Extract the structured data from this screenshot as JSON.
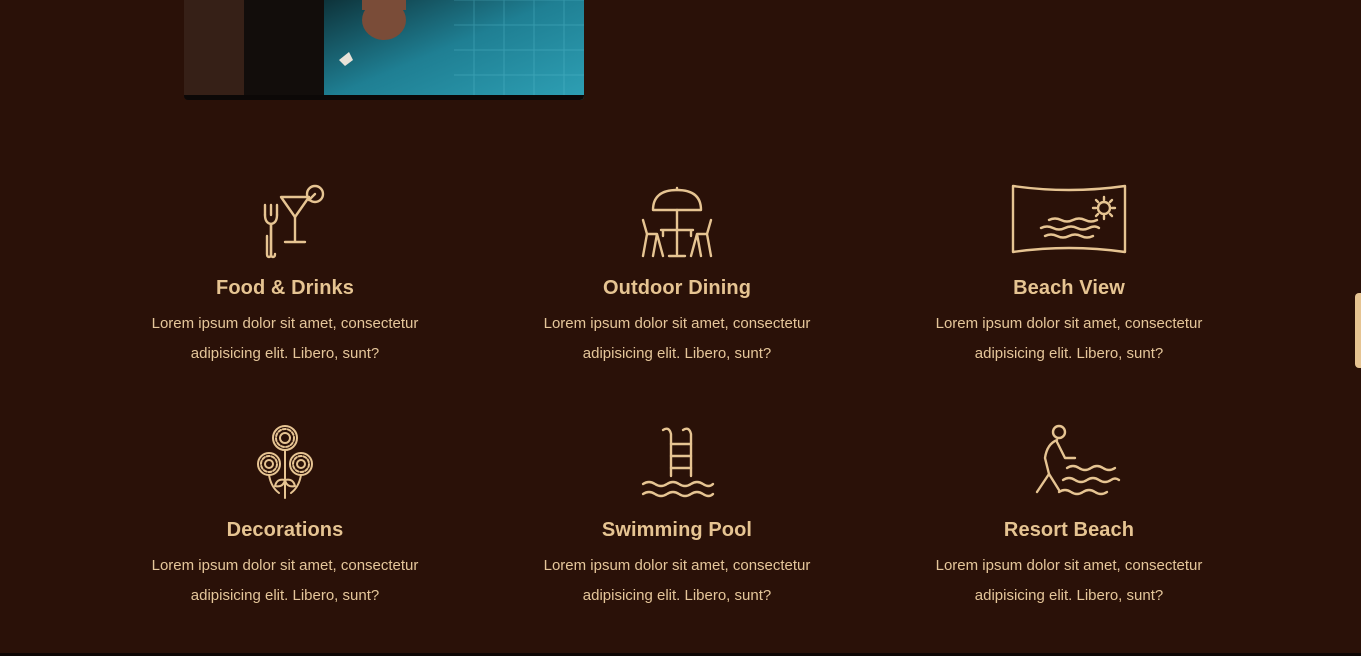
{
  "hero": {
    "image_label": "Person sitting at pool edge with feet in water"
  },
  "colors": {
    "background": "#2a1108",
    "accent": "#e6c492",
    "text": "#e5c69a"
  },
  "features": [
    {
      "icon": "cocktail-fork-icon",
      "title": "Food & Drinks",
      "text": "Lorem ipsum dolor sit amet, consectetur adipisicing elit. Libero, sunt?"
    },
    {
      "icon": "parasol-table-chairs-icon",
      "title": "Outdoor Dining",
      "text": "Lorem ipsum dolor sit amet, consectetur adipisicing elit. Libero, sunt?"
    },
    {
      "icon": "beach-panorama-icon",
      "title": "Beach View",
      "text": "Lorem ipsum dolor sit amet, consectetur adipisicing elit. Libero, sunt?"
    },
    {
      "icon": "flowers-icon",
      "title": "Decorations",
      "text": "Lorem ipsum dolor sit amet, consectetur adipisicing elit. Libero, sunt?"
    },
    {
      "icon": "pool-ladder-icon",
      "title": "Swimming Pool",
      "text": "Lorem ipsum dolor sit amet, consectetur adipisicing elit. Libero, sunt?"
    },
    {
      "icon": "person-waves-icon",
      "title": "Resort Beach",
      "text": "Lorem ipsum dolor sit amet, consectetur adipisicing elit. Libero, sunt?"
    }
  ]
}
